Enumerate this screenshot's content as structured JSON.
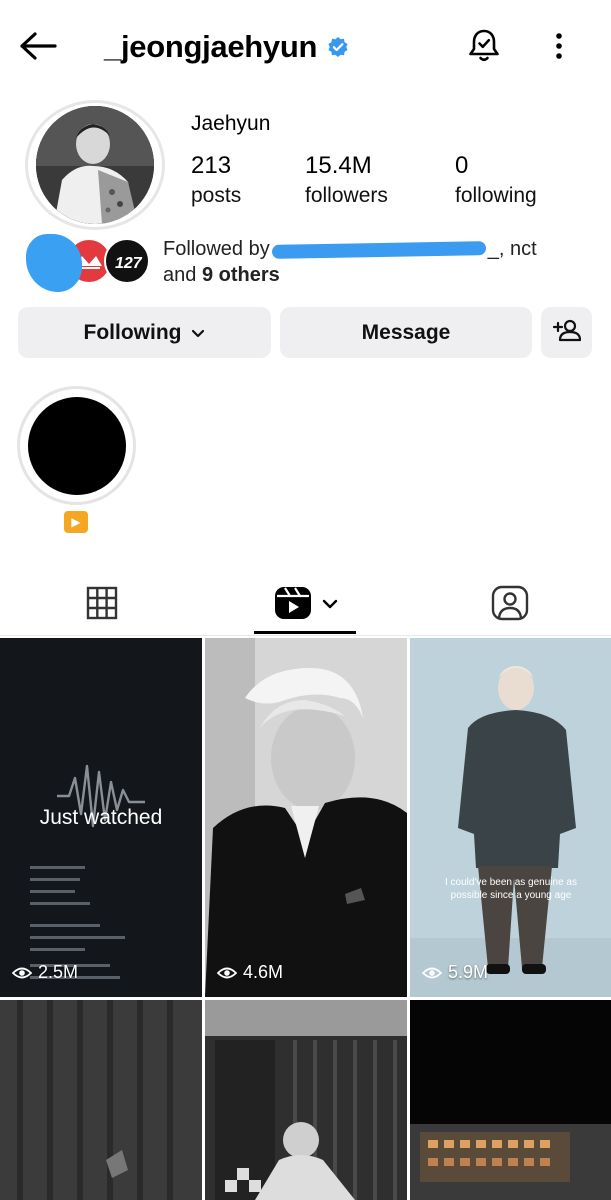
{
  "header": {
    "username": "_jeongjaehyun",
    "verified": true
  },
  "profile": {
    "display_name": "Jaehyun",
    "stats": [
      {
        "value": "213",
        "label": "posts"
      },
      {
        "value": "15.4M",
        "label": "followers"
      },
      {
        "value": "0",
        "label": "following"
      }
    ],
    "followed_by": {
      "prefix": "Followed by",
      "tail_name": "_, nct",
      "line2_and": "and",
      "others": "9 others"
    }
  },
  "actions": {
    "following_label": "Following",
    "message_label": "Message"
  },
  "highlight": {
    "label_icon": "play-button-emoji"
  },
  "tabs": [
    {
      "name": "grid-icon",
      "active": false
    },
    {
      "name": "reels-icon",
      "active": true
    },
    {
      "name": "tagged-icon",
      "active": false
    }
  ],
  "reels": [
    {
      "views": "2.5M",
      "overlay": "Just watched"
    },
    {
      "views": "4.6M"
    },
    {
      "views": "5.9M",
      "caption": "I could've been as genuine as possible since a young age"
    },
    {},
    {},
    {}
  ],
  "colors": {
    "button_bg": "#efeff1",
    "verified_blue": "#3897f0",
    "redaction_blue": "#3b9bf0"
  }
}
